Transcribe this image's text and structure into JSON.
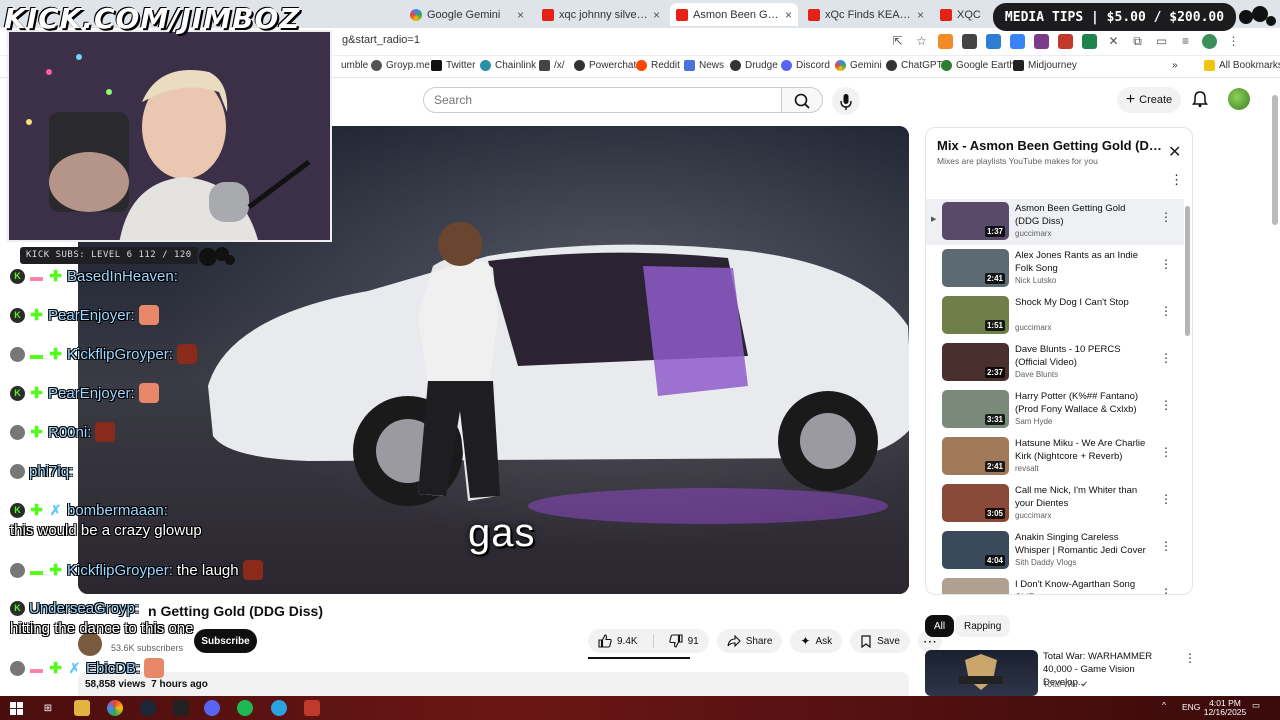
{
  "browser": {
    "tabs": [
      {
        "label": "Google Gemini",
        "icon": "gemini-icon",
        "active": false
      },
      {
        "label": "xqc johnny silverhand -",
        "icon": "youtube-icon",
        "active": false
      },
      {
        "label": "Asmon Been Getting Gold",
        "icon": "youtube-icon",
        "active": true
      },
      {
        "label": "xQc Finds KEANU REEV",
        "icon": "youtube-icon",
        "active": false
      },
      {
        "label": "XQC",
        "icon": "youtube-icon",
        "active": false
      }
    ],
    "url": "g&start_radio=1",
    "bookmarks": [
      "umble",
      "Groyp.me",
      "Twitter",
      "Chainlink",
      "/x/",
      "Powerchat",
      "Reddit",
      "News",
      "Drudge",
      "Discord",
      "Gemini",
      "ChatGPT",
      "Google Earth",
      "Midjourney"
    ],
    "all_bookmarks": "All Bookmarks",
    "more_bookmarks": "»"
  },
  "youtube": {
    "search_placeholder": "Search",
    "create_label": "Create"
  },
  "player": {
    "caption": "gas"
  },
  "video": {
    "title_visible": "n Getting Gold (DDG Diss)",
    "subscribers": "53.6K subscribers",
    "subscribe_label": "Subscribe",
    "likes": "9.4K",
    "dislikes": "91",
    "share_label": "Share",
    "ask_label": "Ask",
    "save_label": "Save",
    "views": "58,858 views",
    "posted": "7 hours ago"
  },
  "playlist": {
    "title": "Mix - Asmon Been Getting Gold (DD...",
    "subtitle": "Mixes are playlists YouTube makes for you",
    "items": [
      {
        "title": "Asmon Been Getting Gold (DDG Diss)",
        "channel": "guccimarx",
        "duration": "1:37",
        "current": true,
        "thumb": "#5a4a6a"
      },
      {
        "title": "Alex Jones Rants as an Indie Folk Song",
        "channel": "Nick Lutsko",
        "duration": "2:41",
        "current": false,
        "thumb": "#5c6b72"
      },
      {
        "title": "Shock My Dog I Can't Stop",
        "channel": "guccimarx",
        "duration": "1:51",
        "current": false,
        "thumb": "#6f7f4a"
      },
      {
        "title": "Dave Blunts - 10 PERCS (Official Video)",
        "channel": "Dave Blunts",
        "duration": "2:37",
        "current": false,
        "thumb": "#4a2f2f"
      },
      {
        "title": "Harry Potter (K%## Fantano) (Prod Fony Wallace & Cxlxb)",
        "channel": "Sam Hyde",
        "duration": "3:31",
        "current": false,
        "thumb": "#7a8a7a"
      },
      {
        "title": "Hatsune Miku - We Are Charlie Kirk (Nightcore + Reverb)",
        "channel": "revsalt",
        "duration": "2:41",
        "current": false,
        "thumb": "#a07a5a"
      },
      {
        "title": "Call me Nick, I'm Whiter than your Dientes",
        "channel": "guccimarx",
        "duration": "3:05",
        "current": false,
        "thumb": "#8a4a3a"
      },
      {
        "title": "Anakin Singing Careless Whisper | Romantic Jedi Cover",
        "channel": "Sith Daddy Vlogs",
        "duration": "4:04",
        "current": false,
        "thumb": "#3a4a5a"
      },
      {
        "title": "I Don't Know-Agarthan Song ShiPost",
        "channel": "",
        "duration": "",
        "current": false,
        "thumb": "#b0a090"
      }
    ]
  },
  "chips": [
    "All",
    "Rapping"
  ],
  "recommendation": {
    "title": "Total War: WARHAMMER 40,000 - Game Vision Develop...",
    "channel": "Total War ✔"
  },
  "overlay": {
    "url_text": "KICK.COM/JIMBOZ",
    "subs_bar": "KICK SUBS: LEVEL 6 112 / 120",
    "media_tips": "MEDIA TIPS | $5.00 / $200.00",
    "chat": [
      {
        "user": "BasedInHeaven:",
        "msg": ""
      },
      {
        "user": "PearEnjoyer:",
        "msg": ""
      },
      {
        "user": "KickflipGroyper:",
        "msg": ""
      },
      {
        "user": "PearEnjoyer:",
        "msg": ""
      },
      {
        "user": "R00ni:",
        "msg": ""
      },
      {
        "user": "phi7iq:",
        "msg": ""
      },
      {
        "user": "bombermaaan:",
        "msg": "this would be a crazy glowup"
      },
      {
        "user": "KickflipGroyper:",
        "msg": "the laugh"
      },
      {
        "user": "UnderseaGroyp:",
        "msg": "hitting the dance to this one"
      },
      {
        "user": "EbicDB:",
        "msg": ""
      }
    ]
  },
  "taskbar": {
    "language": "ENG",
    "time": "4:01 PM",
    "date": "12/16/2025"
  }
}
